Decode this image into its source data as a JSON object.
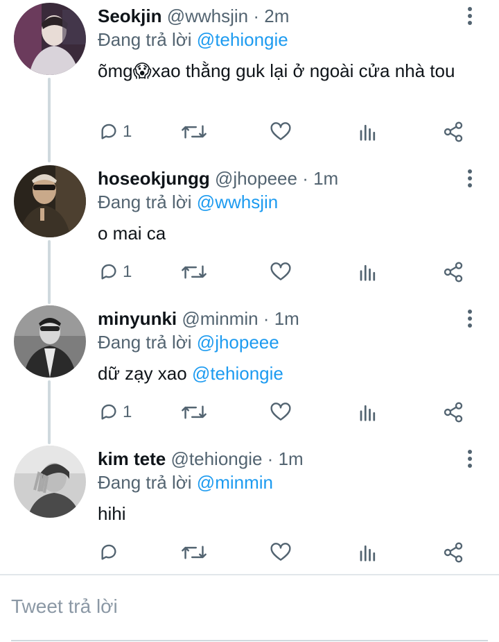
{
  "tweets": [
    {
      "name": "Seokjin",
      "handle": "@wwhsjin",
      "separator": "·",
      "time": "2m",
      "replying_prefix": "Đang trả lời",
      "replying_to": "@tehiongie",
      "text_before": "õmg",
      "emoji": "😱",
      "text_after": "xao thằng guk lại ở ngoài cửa nhà tou",
      "reply_count": "1"
    },
    {
      "name": "hoseokjungg",
      "handle": "@jhopeee",
      "separator": "·",
      "time": "1m",
      "replying_prefix": "Đang trả lời",
      "replying_to": "@wwhsjin",
      "text": "o mai ca",
      "reply_count": "1"
    },
    {
      "name": "minyunki",
      "handle": "@minmin",
      "separator": "·",
      "time": "1m",
      "replying_prefix": "Đang trả lời",
      "replying_to": "@jhopeee",
      "text": "dữ zạy xao",
      "mention": "@tehiongie",
      "reply_count": "1"
    },
    {
      "name": "kim tete",
      "handle": "@tehiongie",
      "separator": "·",
      "time": "1m",
      "replying_prefix": "Đang trả lời",
      "replying_to": "@minmin",
      "text": "hihi",
      "reply_count": ""
    }
  ],
  "composer": {
    "placeholder": "Tweet trả lời"
  },
  "icons": [
    "reply-icon",
    "retweet-icon",
    "like-icon",
    "analytics-icon",
    "share-icon",
    "more-icon"
  ],
  "colors": {
    "accent": "#1d9bf0",
    "secondary_text": "#536471",
    "thread_line": "#cfd9de"
  }
}
